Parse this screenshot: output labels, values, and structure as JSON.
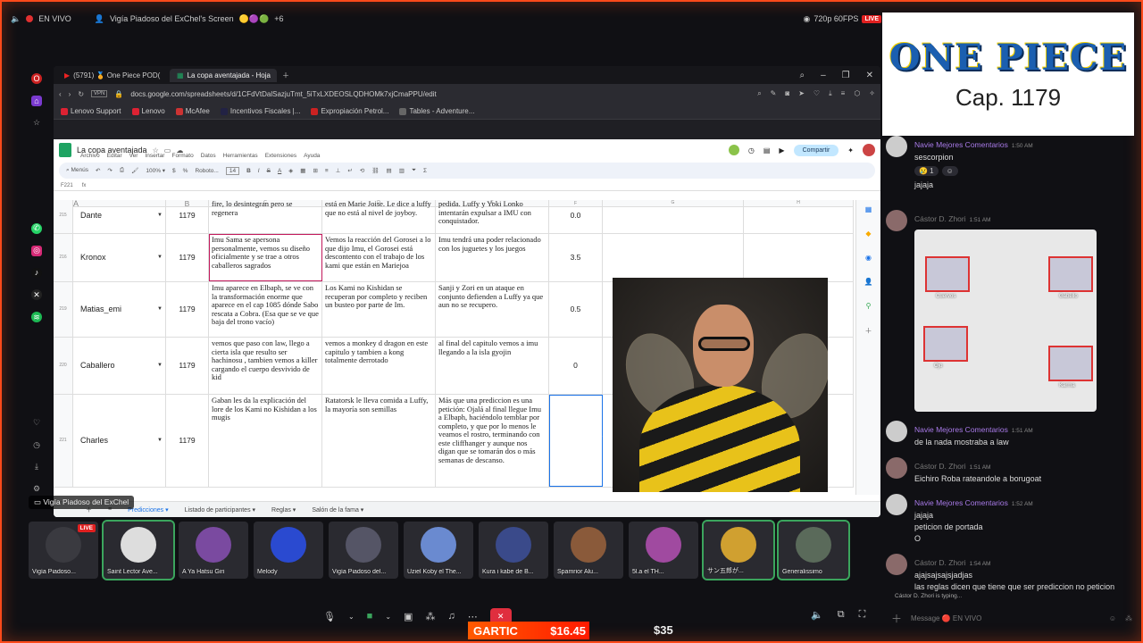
{
  "stream": {
    "live_label": "EN VIVO",
    "title": "Vigía Piadoso del ExChel's Screen",
    "viewer_extra": "+6",
    "quality": "720p 60FPS",
    "live_badge": "LIVE"
  },
  "browser": {
    "tabs": [
      {
        "label": "(5791) 🏅 One Piece POD("
      },
      {
        "label": "La copa aventajada - Hoja"
      }
    ],
    "url": "docs.google.com/spreadsheets/d/1CFdVtDalSazjuTmt_5iTxLXDEOSLQDHOMk7xjCmaPPU/edit",
    "vpn": "VPN",
    "bookmarks": [
      "Lenovo Support",
      "Lenovo",
      "McAfee",
      "Incentivos Fiscales |...",
      "Expropiación Petrol...",
      "Tables - Adventure..."
    ],
    "bookmark_colors": [
      "#d23",
      "#d23",
      "#c33",
      "#224",
      "#c22",
      "#666"
    ]
  },
  "sheet": {
    "title": "La copa aventajada",
    "menu": [
      "Archivo",
      "Editar",
      "Ver",
      "Insertar",
      "Formato",
      "Datos",
      "Herramientas",
      "Extensiones",
      "Ayuda"
    ],
    "share": "Compartir",
    "toolbar": {
      "menus": "Menús",
      "font": "Roboto...",
      "size": "14"
    },
    "cell_ref": "F221",
    "col_headers": [
      "A",
      "B",
      "C",
      "D",
      "E",
      "F",
      "G",
      "H"
    ],
    "rows": [
      {
        "num": "215",
        "name": "Dante",
        "num2": "1179",
        "c": "fire, lo desintegran pero se regenera",
        "d": "está en Marie Joise. Le dice a luffy que no está al nivel de joyboy.",
        "e": "pedida. Luffy y Yoki Lonko intentarán expulsar a IMU con conquistador.",
        "f": "0.0"
      },
      {
        "num": "216",
        "name": "Kronox",
        "num2": "1179",
        "c": "Imu Sama se apersona personalmente, vemos su diseño oficialmente y se trae a otros caballeros sagrados",
        "d": "Vemos la reacción del Gorosei a lo que dijo Imu, el Gorosei está descontento con el trabajo de los kami que están en Mariejoa",
        "e": "Imu tendrá una poder relacionado con los juguetes y los juegos",
        "f": "3.5"
      },
      {
        "num": "219",
        "name": "Matias_emi",
        "num2": "1179",
        "c": "Imu aparece en Elbaph, se ve con la transformación enorme que aparece en el cap 1085 dónde Sabo rescata a Cobra. (Esa que se ve que baja del trono vacío)",
        "d": "Los Kami no Kishidan se recuperan por completo y reciben un busteo  por parte de Im.",
        "e": "Sanji y Zori en un ataque en conjunto defienden a Luffy ya que aun no se recupero.",
        "f": "0.5"
      },
      {
        "num": "220",
        "name": "Caballero",
        "num2": "1179",
        "c": "vemos que paso con law, llego a cierta isla que resulto ser hachinosu , tambien vemos a killer cargando el cuerpo desvivido de kid",
        "d": " vemos a monkey d dragon en este capitulo y tambien a kong totalmente derrotado",
        "e": " al final del capitulo vemos a imu llegando a la isla gyojin",
        "f": "0"
      },
      {
        "num": "221",
        "name": "Charles",
        "num2": "1179",
        "c": "Gaban les da la explicación del lore de los Kami no Kishidan a los mugis",
        "d": "Ratatorsk le lleva comida a Luffy, la mayoría son semillas",
        "e": "Más que una prediccion es una petición: Ojalá al final llegue Imu a Elbaph, haciéndolo temblar por completo, y que por lo menos le veamos el rostro, terminando con este cliffhanger y aunque nos digan que se tomarán dos o más semanas de descanso.",
        "f": ""
      }
    ],
    "footer_tabs": [
      "Predicciones",
      "Listado de participantes",
      "Reglas",
      "Salón de la fama"
    ]
  },
  "share_label": "Vigía Piadoso del ExChel",
  "participants": [
    {
      "name": "Vigía Piadoso...",
      "live": "LIVE",
      "color": "#3a3a40"
    },
    {
      "name": "Saint Lector Ave...",
      "color": "#ddd"
    },
    {
      "name": "A Ya Hatsu Giri",
      "color": "#7a4aa0"
    },
    {
      "name": "Melody",
      "color": "#2a4ad0"
    },
    {
      "name": "Vigía Piadoso del...",
      "color": "#556"
    },
    {
      "name": "Uziel Koby el The...",
      "color": "#6a8ad0"
    },
    {
      "name": "Kura i kabe de B...",
      "color": "#3a4a8a"
    },
    {
      "name": "Spamrior Alu...",
      "color": "#8a5a3a"
    },
    {
      "name": "5l.a el TH...",
      "color": "#a04aa0"
    },
    {
      "name": "サン五郎が...",
      "color": "#d0a030"
    },
    {
      "name": "Generalissimo",
      "color": "#5a6a5a"
    }
  ],
  "controls": {
    "end": "✕"
  },
  "gartic": {
    "label": "GARTIC",
    "price": "$16.45",
    "price2": "$35"
  },
  "banner": {
    "logo": "ONE PIECE",
    "chapter": "Cap. 1179"
  },
  "chat": [
    {
      "author": "Navie Mejores Comentarios",
      "time": "1:50 AM",
      "lines": [
        "sescorpion"
      ],
      "reacts": [
        "😢 1",
        "☺"
      ],
      "av": "#ccc"
    },
    {
      "author": "",
      "time": "",
      "lines": [
        "jajaja"
      ],
      "av": ""
    },
    {
      "author": "Cástor D. Zhori",
      "time": "1:51 AM",
      "grey": true,
      "lines": [],
      "image": true,
      "av": "#8a6a6a"
    },
    {
      "author": "Navie Mejores Comentarios",
      "time": "1:51 AM",
      "lines": [
        "de la nada mostraba a law"
      ],
      "av": "#ccc"
    },
    {
      "author": "Cástor D. Zhori",
      "time": "1:51 AM",
      "grey": true,
      "lines": [
        "Eichiro Roba rateandole a borugoat"
      ],
      "av": "#8a6a6a"
    },
    {
      "author": "Navie Mejores Comentarios",
      "time": "1:52 AM",
      "lines": [
        "jajaja",
        "peticion de portada",
        "O"
      ],
      "av": "#ccc"
    },
    {
      "author": "Cástor D. Zhori",
      "time": "1:54 AM",
      "grey": true,
      "lines": [
        "ajajsajsajsjadjas",
        "las reglas dicen que tiene que ser prediccion no peticion"
      ],
      "av": "#8a6a6a"
    }
  ],
  "chat_image_labels": [
    "Cuervos",
    "Gabello",
    "Ojo",
    "Karma"
  ],
  "typing": "Cástor D. Zhori is typing...",
  "input_placeholder": "Message 🔴 EN VIVO"
}
